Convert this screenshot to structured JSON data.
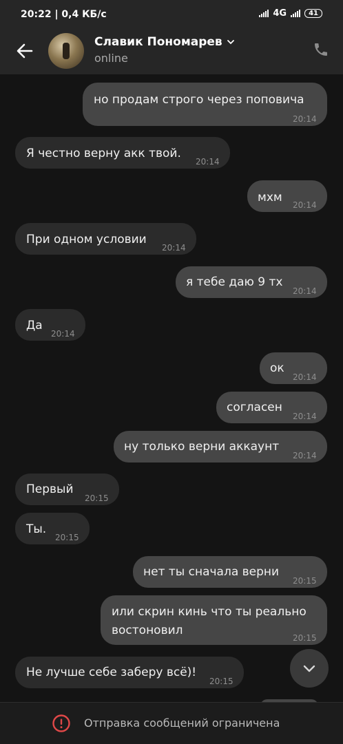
{
  "statusbar": {
    "time": "20:22 | 0,4 КБ/с",
    "network": "4G",
    "battery": "41"
  },
  "header": {
    "contact_name": "Славик Пономарев",
    "contact_status": "online"
  },
  "messages": [
    {
      "dir": "out",
      "text": "но продам строго через поповича",
      "time": "20:14"
    },
    {
      "dir": "in",
      "text": "Я честно верну акк твой.",
      "time": "20:14"
    },
    {
      "dir": "out",
      "text": "мхм",
      "time": "20:14"
    },
    {
      "dir": "in",
      "text": "При одном условии",
      "time": "20:14"
    },
    {
      "dir": "out",
      "text": "я тебе даю 9 тх",
      "time": "20:14"
    },
    {
      "dir": "in",
      "text": "Да",
      "time": "20:14"
    },
    {
      "dir": "out",
      "text": "ок",
      "time": "20:14"
    },
    {
      "dir": "out",
      "text": "согласен",
      "time": "20:14"
    },
    {
      "dir": "out",
      "text": "ну только верни аккаунт",
      "time": "20:14"
    },
    {
      "dir": "in",
      "text": "Первый",
      "time": "20:15"
    },
    {
      "dir": "in",
      "text": "Ты.",
      "time": "20:15"
    },
    {
      "dir": "out",
      "text": "нет ты сначала верни",
      "time": "20:15"
    },
    {
      "dir": "out",
      "text": "или скрин кинь что ты реально востоновил",
      "time": "20:15"
    },
    {
      "dir": "in",
      "text": "Не лучше себе заберу всё)!",
      "time": "20:15"
    }
  ],
  "bottom": {
    "restriction_text": "Отправка сообщений ограничена"
  },
  "icons": {
    "back": "back-arrow-icon",
    "phone": "phone-icon",
    "scroll": "chevron-down-icon",
    "warning": "warning-circle-icon"
  },
  "colors": {
    "background": "#141414",
    "outgoing_bubble": "#464646",
    "incoming_bubble": "#2b2b2b",
    "warning": "#e04848"
  }
}
